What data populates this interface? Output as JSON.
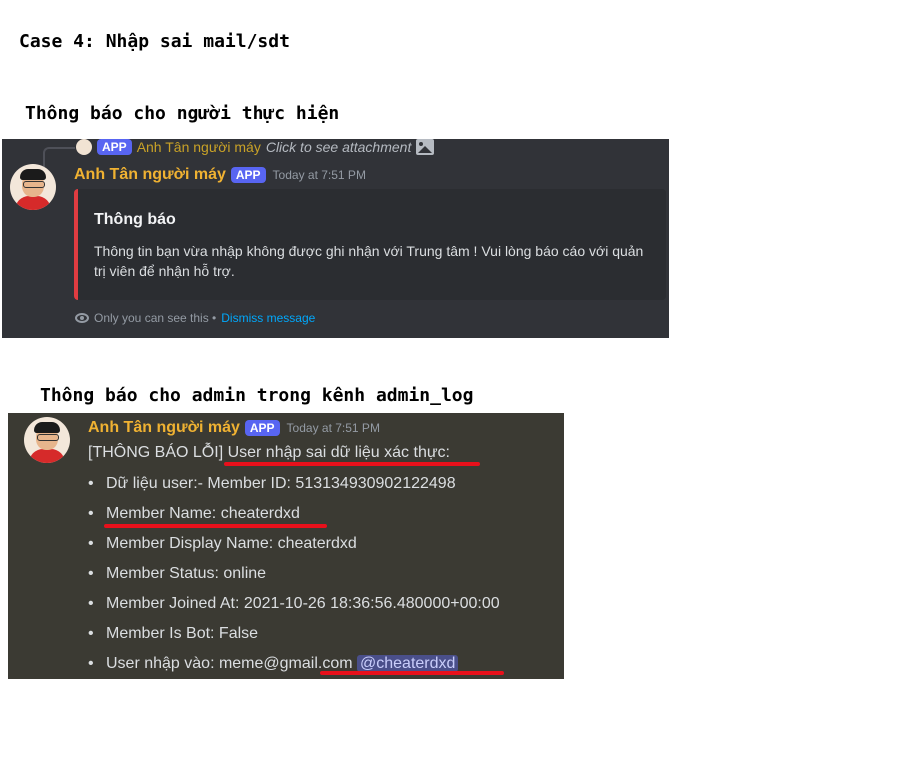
{
  "heading_case": "Case 4: Nhập sai mail/sdt",
  "heading_user": "Thông báo cho người thực hiện",
  "heading_admin": "Thông báo cho admin trong kênh admin_log",
  "panel1": {
    "reply": {
      "badge": "APP",
      "name": "Anh Tân người máy",
      "text": "Click to see attachment"
    },
    "bot_name": "Anh Tân người máy",
    "badge": "APP",
    "timestamp": "Today at 7:51 PM",
    "embed": {
      "title": "Thông báo",
      "description": "Thông tin bạn vừa nhập không được ghi nhận với Trung tâm ! Vui lòng báo cáo với quản trị viên để nhận hỗ trợ.",
      "accent": "#e03c41"
    },
    "ephemeral_text": "Only you can see this •",
    "dismiss_label": "Dismiss message"
  },
  "panel2": {
    "bot_name": "Anh Tân người máy",
    "badge": "APP",
    "timestamp": "Today at 7:51 PM",
    "first_line": "[THÔNG BÁO LỖI] User nhập sai dữ liệu xác thực:",
    "items": [
      "Dữ liệu user:- Member ID: 513134930902122498",
      "Member Name: cheaterdxd",
      "Member Display Name: cheaterdxd",
      "Member Status: online",
      "Member Joined At: 2021-10-26 18:36:56.480000+00:00",
      "Member Is Bot: False"
    ],
    "last_item": "User nhập vào: meme@gmail.com",
    "mention": "@cheaterdxd"
  },
  "colors": {
    "panel1_bg": "#313338",
    "panel2_bg": "#3b3a33",
    "app_badge": "#5865f2",
    "bot_name": "#f0b232",
    "link": "#00a8fc",
    "underline": "#e8101b"
  }
}
